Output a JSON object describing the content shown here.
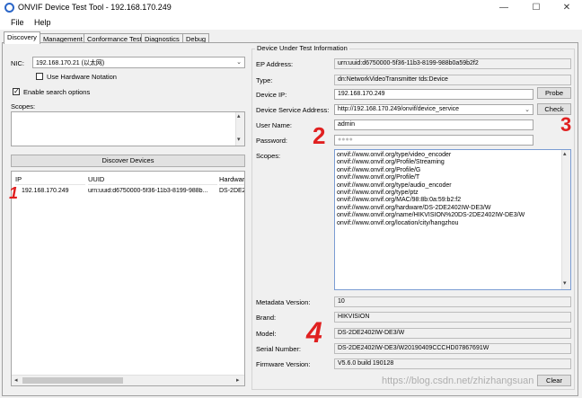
{
  "window": {
    "title": "ONVIF Device Test Tool - 192.168.170.249",
    "minimize_glyph": "—",
    "maximize_glyph": "☐",
    "close_glyph": "✕"
  },
  "menu": [
    "File",
    "Help"
  ],
  "tabs": [
    "Discovery",
    "Management",
    "Conformance Test",
    "Diagnostics",
    "Debug"
  ],
  "discovery": {
    "nic_label": "NIC:",
    "nic_value": "192.168.170.21 (以太网)",
    "hw_notation_label": "Use Hardware Notation",
    "hw_notation_checked": false,
    "enable_search_label": "Enable search options",
    "enable_search_checked": true,
    "scopes_label": "Scopes:",
    "discover_button": "Discover Devices",
    "columns": [
      "IP",
      "UUID",
      "Hardwar"
    ],
    "rows": [
      {
        "ip": "192.168.170.249",
        "uuid": "urn:uuid:d6750000-5f36-11b3-8199-988b...",
        "hw": "DS-2DE2"
      }
    ]
  },
  "dut": {
    "group_title": "Device Under Test Information",
    "ep_address_label": "EP Address:",
    "ep_address_value": "urn:uuid:d6750000-5f36-11b3-8199-988b0a59b2f2",
    "type_label": "Type:",
    "type_value": "dn:NetworkVideoTransmitter tds:Device",
    "device_ip_label": "Device IP:",
    "device_ip_value": "192.168.170.249",
    "probe_button": "Probe",
    "service_address_label": "Device Service Address:",
    "service_address_value": "http://192.168.170.249/onvif/device_service",
    "check_button": "Check",
    "username_label": "User Name:",
    "username_value": "admin",
    "password_label": "Password:",
    "password_value": "●●●●",
    "scopes_label": "Scopes:",
    "scopes_lines": [
      "onvif://www.onvif.org/type/video_encoder",
      "onvif://www.onvif.org/Profile/Streaming",
      "onvif://www.onvif.org/Profile/G",
      "onvif://www.onvif.org/Profile/T",
      "onvif://www.onvif.org/type/audio_encoder",
      "onvif://www.onvif.org/type/ptz",
      "onvif://www.onvif.org/MAC/98:8b:0a:59:b2:f2",
      "onvif://www.onvif.org/hardware/DS-2DE2402IW-DE3/W",
      "onvif://www.onvif.org/name/HIKVISION%20DS-2DE2402IW-DE3/W",
      "onvif://www.onvif.org/location/city/hangzhou"
    ],
    "metadata_label": "Metadata Version:",
    "metadata_value": "10",
    "brand_label": "Brand:",
    "brand_value": "HIKVISION",
    "model_label": "Model:",
    "model_value": "DS-2DE2402IW-DE3/W",
    "serial_label": "Serial Number:",
    "serial_value": "DS-2DE2402IW-DE3/W20190409CCCHD07867691W",
    "firmware_label": "Firmware Version:",
    "firmware_value": "V5.6.0 build 190128",
    "clear_button": "Clear"
  },
  "annotations": [
    "1",
    "2",
    "3",
    "4"
  ],
  "watermark": "https://blog.csdn.net/zhizhangsuan",
  "colors": {
    "annotation": "#e02020",
    "accent": "#2b66c8"
  }
}
